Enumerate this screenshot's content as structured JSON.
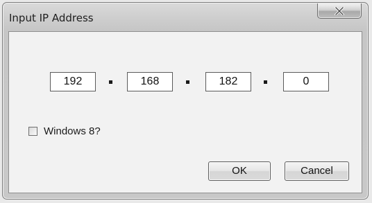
{
  "window": {
    "title": "Input IP Address"
  },
  "titlebar": {
    "close_icon": "close-icon"
  },
  "ip_fields": {
    "octet1": "192",
    "octet2": "168",
    "octet3": "182",
    "octet4": "0"
  },
  "options": {
    "windows8_label": "Windows 8?",
    "windows8_checked": false
  },
  "buttons": {
    "ok_label": "OK",
    "cancel_label": "Cancel"
  }
}
